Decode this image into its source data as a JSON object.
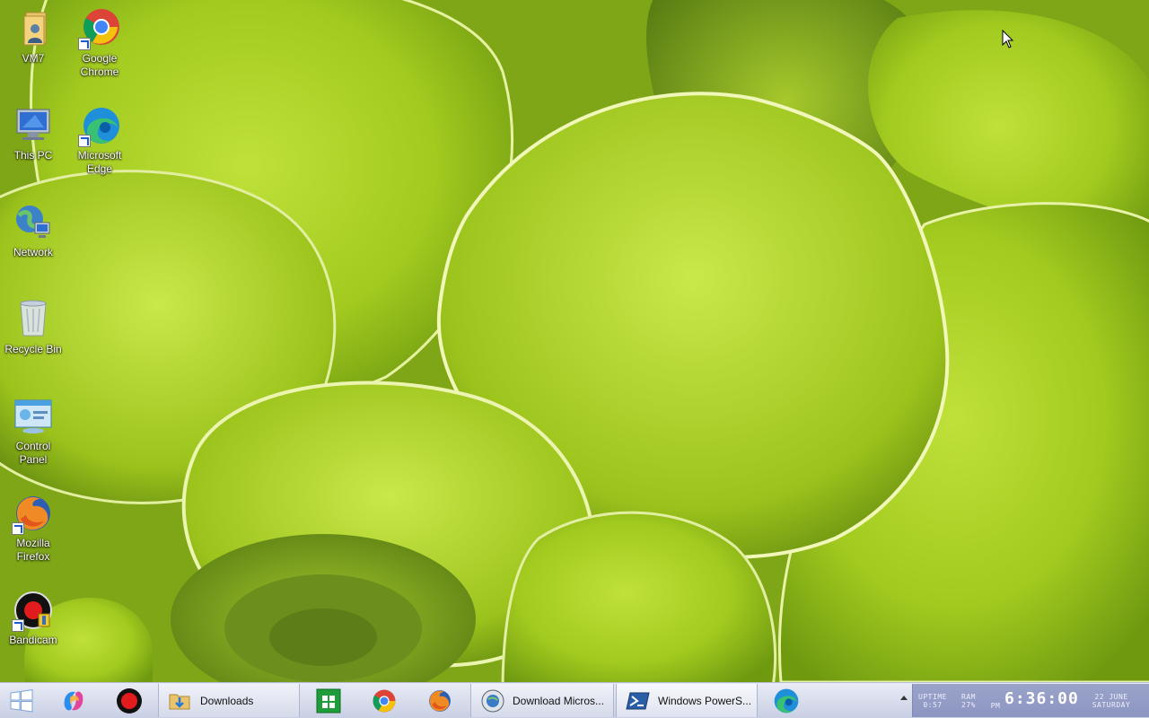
{
  "desktop": {
    "icons": [
      {
        "id": "vm7",
        "label": "VM7",
        "icon": "folder-user-icon"
      },
      {
        "id": "chrome",
        "label": "Google\nChrome",
        "icon": "chrome-icon"
      },
      {
        "id": "this-pc",
        "label": "This PC",
        "icon": "computer-icon"
      },
      {
        "id": "edge",
        "label": "Microsoft\nEdge",
        "icon": "edge-icon"
      },
      {
        "id": "network",
        "label": "Network",
        "icon": "network-icon"
      },
      {
        "id": "recycle-bin",
        "label": "Recycle Bin",
        "icon": "recycle-bin-icon"
      },
      {
        "id": "control-panel",
        "label": "Control\nPanel",
        "icon": "control-panel-icon"
      },
      {
        "id": "firefox",
        "label": "Mozilla\nFirefox",
        "icon": "firefox-icon"
      },
      {
        "id": "bandicam",
        "label": "Bandicam",
        "icon": "bandicam-icon"
      }
    ]
  },
  "taskbar": {
    "start_icon": "windows-logo-icon",
    "pinned": [
      {
        "id": "copilot",
        "icon": "copilot-icon"
      },
      {
        "id": "bandicam",
        "icon": "record-icon"
      }
    ],
    "downloads": {
      "label": "Downloads",
      "icon": "folder-download-icon"
    },
    "apps": [
      {
        "id": "store",
        "icon": "store-icon"
      },
      {
        "id": "chrome",
        "icon": "chrome-icon"
      },
      {
        "id": "firefox",
        "icon": "firefox-icon"
      }
    ],
    "windows": [
      {
        "id": "download-microsoft",
        "label": "Download Micros...",
        "icon": "download-globe-icon"
      },
      {
        "id": "powershell",
        "label": "Windows PowerS...",
        "icon": "powershell-icon"
      }
    ],
    "edge_icon": "edge-icon",
    "overflow_icon": "chevron-up-icon"
  },
  "tray": {
    "uptime_label": "UPTIME",
    "uptime_value": "0:57",
    "ram_label": "RAM",
    "ram_value": "27%",
    "ampm": "PM",
    "time": "6:36:00",
    "date": "22 JUNE",
    "day": "SATURDAY"
  },
  "colors": {
    "taskbar": "#d5daea",
    "tray": "#8c96c1",
    "wallpaper": "#9cc21f"
  }
}
